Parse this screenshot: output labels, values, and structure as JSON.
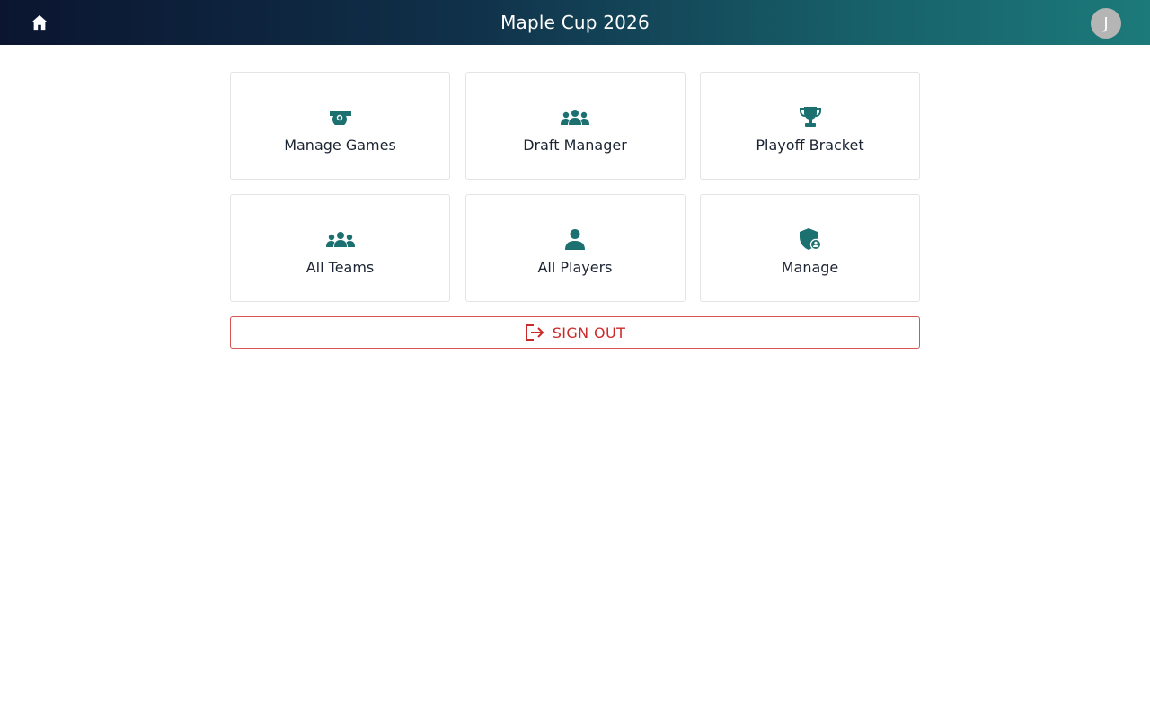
{
  "header": {
    "title": "Maple Cup 2026",
    "home_icon": "home-icon",
    "avatar_initial": "J"
  },
  "tiles": [
    {
      "label": "Manage Games",
      "icon": "whistle-icon"
    },
    {
      "label": "Draft Manager",
      "icon": "group-icon"
    },
    {
      "label": "Playoff Bracket",
      "icon": "trophy-icon"
    },
    {
      "label": "All Teams",
      "icon": "group-icon"
    },
    {
      "label": "All Players",
      "icon": "person-icon"
    },
    {
      "label": "Manage",
      "icon": "admin-shield-icon"
    }
  ],
  "signout": {
    "label": "SIGN OUT",
    "icon": "logout-icon"
  },
  "colors": {
    "accent": "#1c7070",
    "danger": "#cc2a2a",
    "header_start": "#0b1530",
    "header_end": "#1c7a7a"
  }
}
